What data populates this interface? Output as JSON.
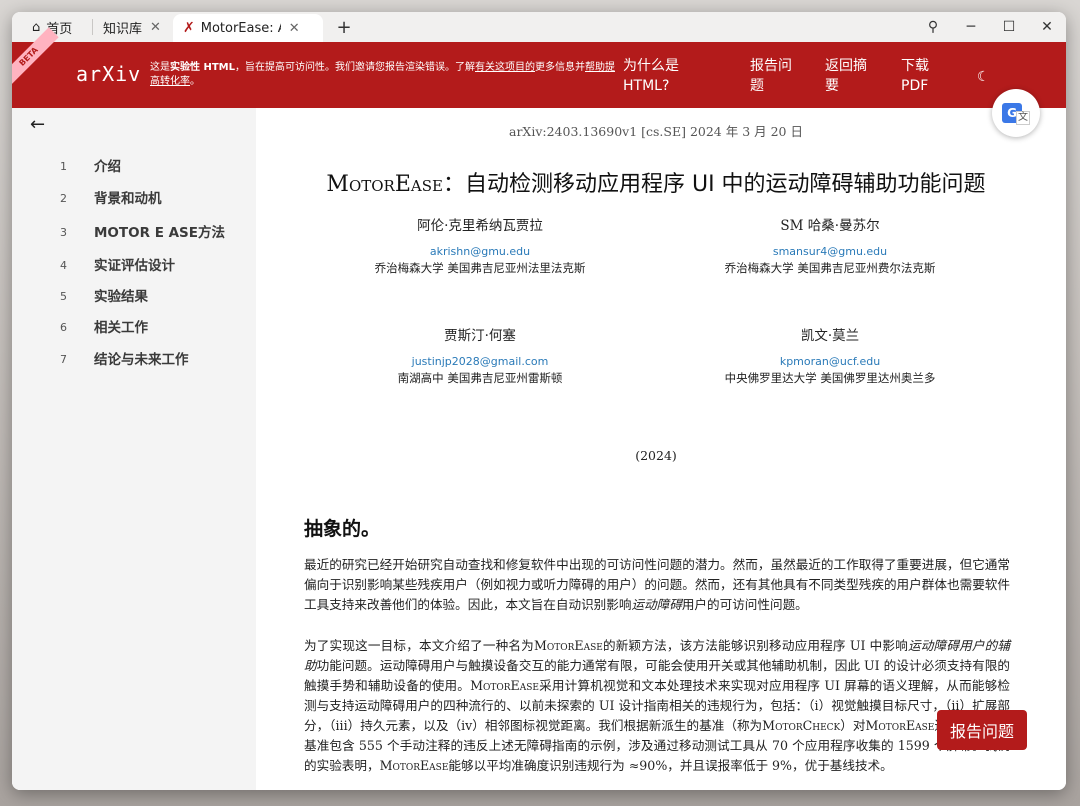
{
  "tabs": {
    "home": "首页",
    "knowledge": "知识库",
    "active": "MotorEase: A..."
  },
  "header": {
    "beta": "BETA",
    "logo": "arXiv",
    "notice_1": "这是",
    "notice_bold": "实验性 HTML",
    "notice_2": "，旨在提高可访问性。我们邀请您报告渲染错误。了解",
    "notice_link1": "有关这项目的",
    "notice_3": "更多信息并",
    "notice_link2": "帮助提高转化率",
    "notice_4": "。",
    "why_html_1": "为什么是",
    "why_html_2": "HTML?",
    "report_1": "报告问",
    "report_2": "题",
    "back_abstract_1": "返回摘",
    "back_abstract_2": "要",
    "download_1": "下载",
    "download_2": "PDF"
  },
  "sidebar": {
    "items": [
      {
        "num": "1",
        "label": "介绍"
      },
      {
        "num": "2",
        "label": "背景和动机"
      },
      {
        "num": "3",
        "label": "MOTOR E ASE方法"
      },
      {
        "num": "4",
        "label": "实证评估设计"
      },
      {
        "num": "5",
        "label": "实验结果"
      },
      {
        "num": "6",
        "label": "相关工作"
      },
      {
        "num": "7",
        "label": "结论与未来工作"
      }
    ]
  },
  "paper": {
    "arxiv_id": "arXiv:2403.13690v1 [cs.SE] 2024 年 3 月 20 日",
    "title_name": "MotorEase",
    "title_rest": "：自动检测移动应用程序 UI 中的运动障碍辅助功能问题",
    "authors": [
      {
        "name": "阿伦·克里希纳瓦贾拉",
        "email": "akrishn@gmu.edu",
        "affil": "乔治梅森大学  美国弗吉尼亚州法里法克斯"
      },
      {
        "name": "SM 哈桑·曼苏尔",
        "email": "smansur4@gmu.edu",
        "affil": "乔治梅森大学  美国弗吉尼亚州费尔法克斯"
      },
      {
        "name": "贾斯汀·何塞",
        "email": "justinjp2028@gmail.com",
        "affil": "南湖高中  美国弗吉尼亚州雷斯顿"
      },
      {
        "name": "凯文·莫兰",
        "email": "kpmoran@ucf.edu",
        "affil": "中央佛罗里达大学  美国佛罗里达州奥兰多"
      }
    ],
    "year": "(2024)",
    "abstract_title": "抽象的。",
    "p1_a": "最近的研究已经开始研究自动查找和修复软件中出现的可访问性问题的潜力。然而，虽然最近的工作取得了重要进展，但它通常偏向于识别影响某些残疾用户（例如视力或听力障碍的用户）的问题。然而，还有其他具有不同类型残疾的用户群体也需要软件工具支持来改善他们的体验。因此，本文旨在自动识别影响",
    "p1_i": "运动障碍",
    "p1_b": "用户的可访问性问题。",
    "p2_a": "为了实现这一目标，本文介绍了一种名为",
    "p2_sc1": "MotorEase",
    "p2_b": "的新颖方法，该方法能够识别移动应用程序 UI 中影响",
    "p2_i": "运动障碍用户的辅助",
    "p2_c": "功能问题。运动障碍用户与触摸设备交互的能力通常有限，可能会使用开关或其他辅助机制，因此 UI 的设计必须支持有限的触摸手势和辅助设备的使用。",
    "p2_sc2": "MotorEase",
    "p2_d": "采用计算机视觉和文本处理技术来实现对应用程序 UI 屏幕的语义理解，从而能够检测与支持运动障碍用户的四种流行的、以前未探索的 UI 设计指南相关的违规行为，包括：（i）视觉触摸目标尺寸，（ii）扩展部分，（iii）持久元素，以及（iv）相邻图标视觉距离。我们根据新派生的基准（称为",
    "p2_sc3": "MotorCheck",
    "p2_e": "）对",
    "p2_sc4": "MotorEase",
    "p2_f": "进行评估，该基准包含 555 个手动注释的违反上述无障碍指南的示例，涉及通过移动测试工具从 70 个应用程序收集的 1599 个屏幕。我们的实验表明，",
    "p2_sc5": "MotorEase",
    "p2_g": "能够以平均准确度识别违规行为 ≈90%，并且误报率低于 9%，优于基线技术。"
  },
  "floating": {
    "report_button": "报告问题"
  },
  "colors": {
    "brand_red": "#b31b1b",
    "link_blue": "#2a7ab8"
  }
}
